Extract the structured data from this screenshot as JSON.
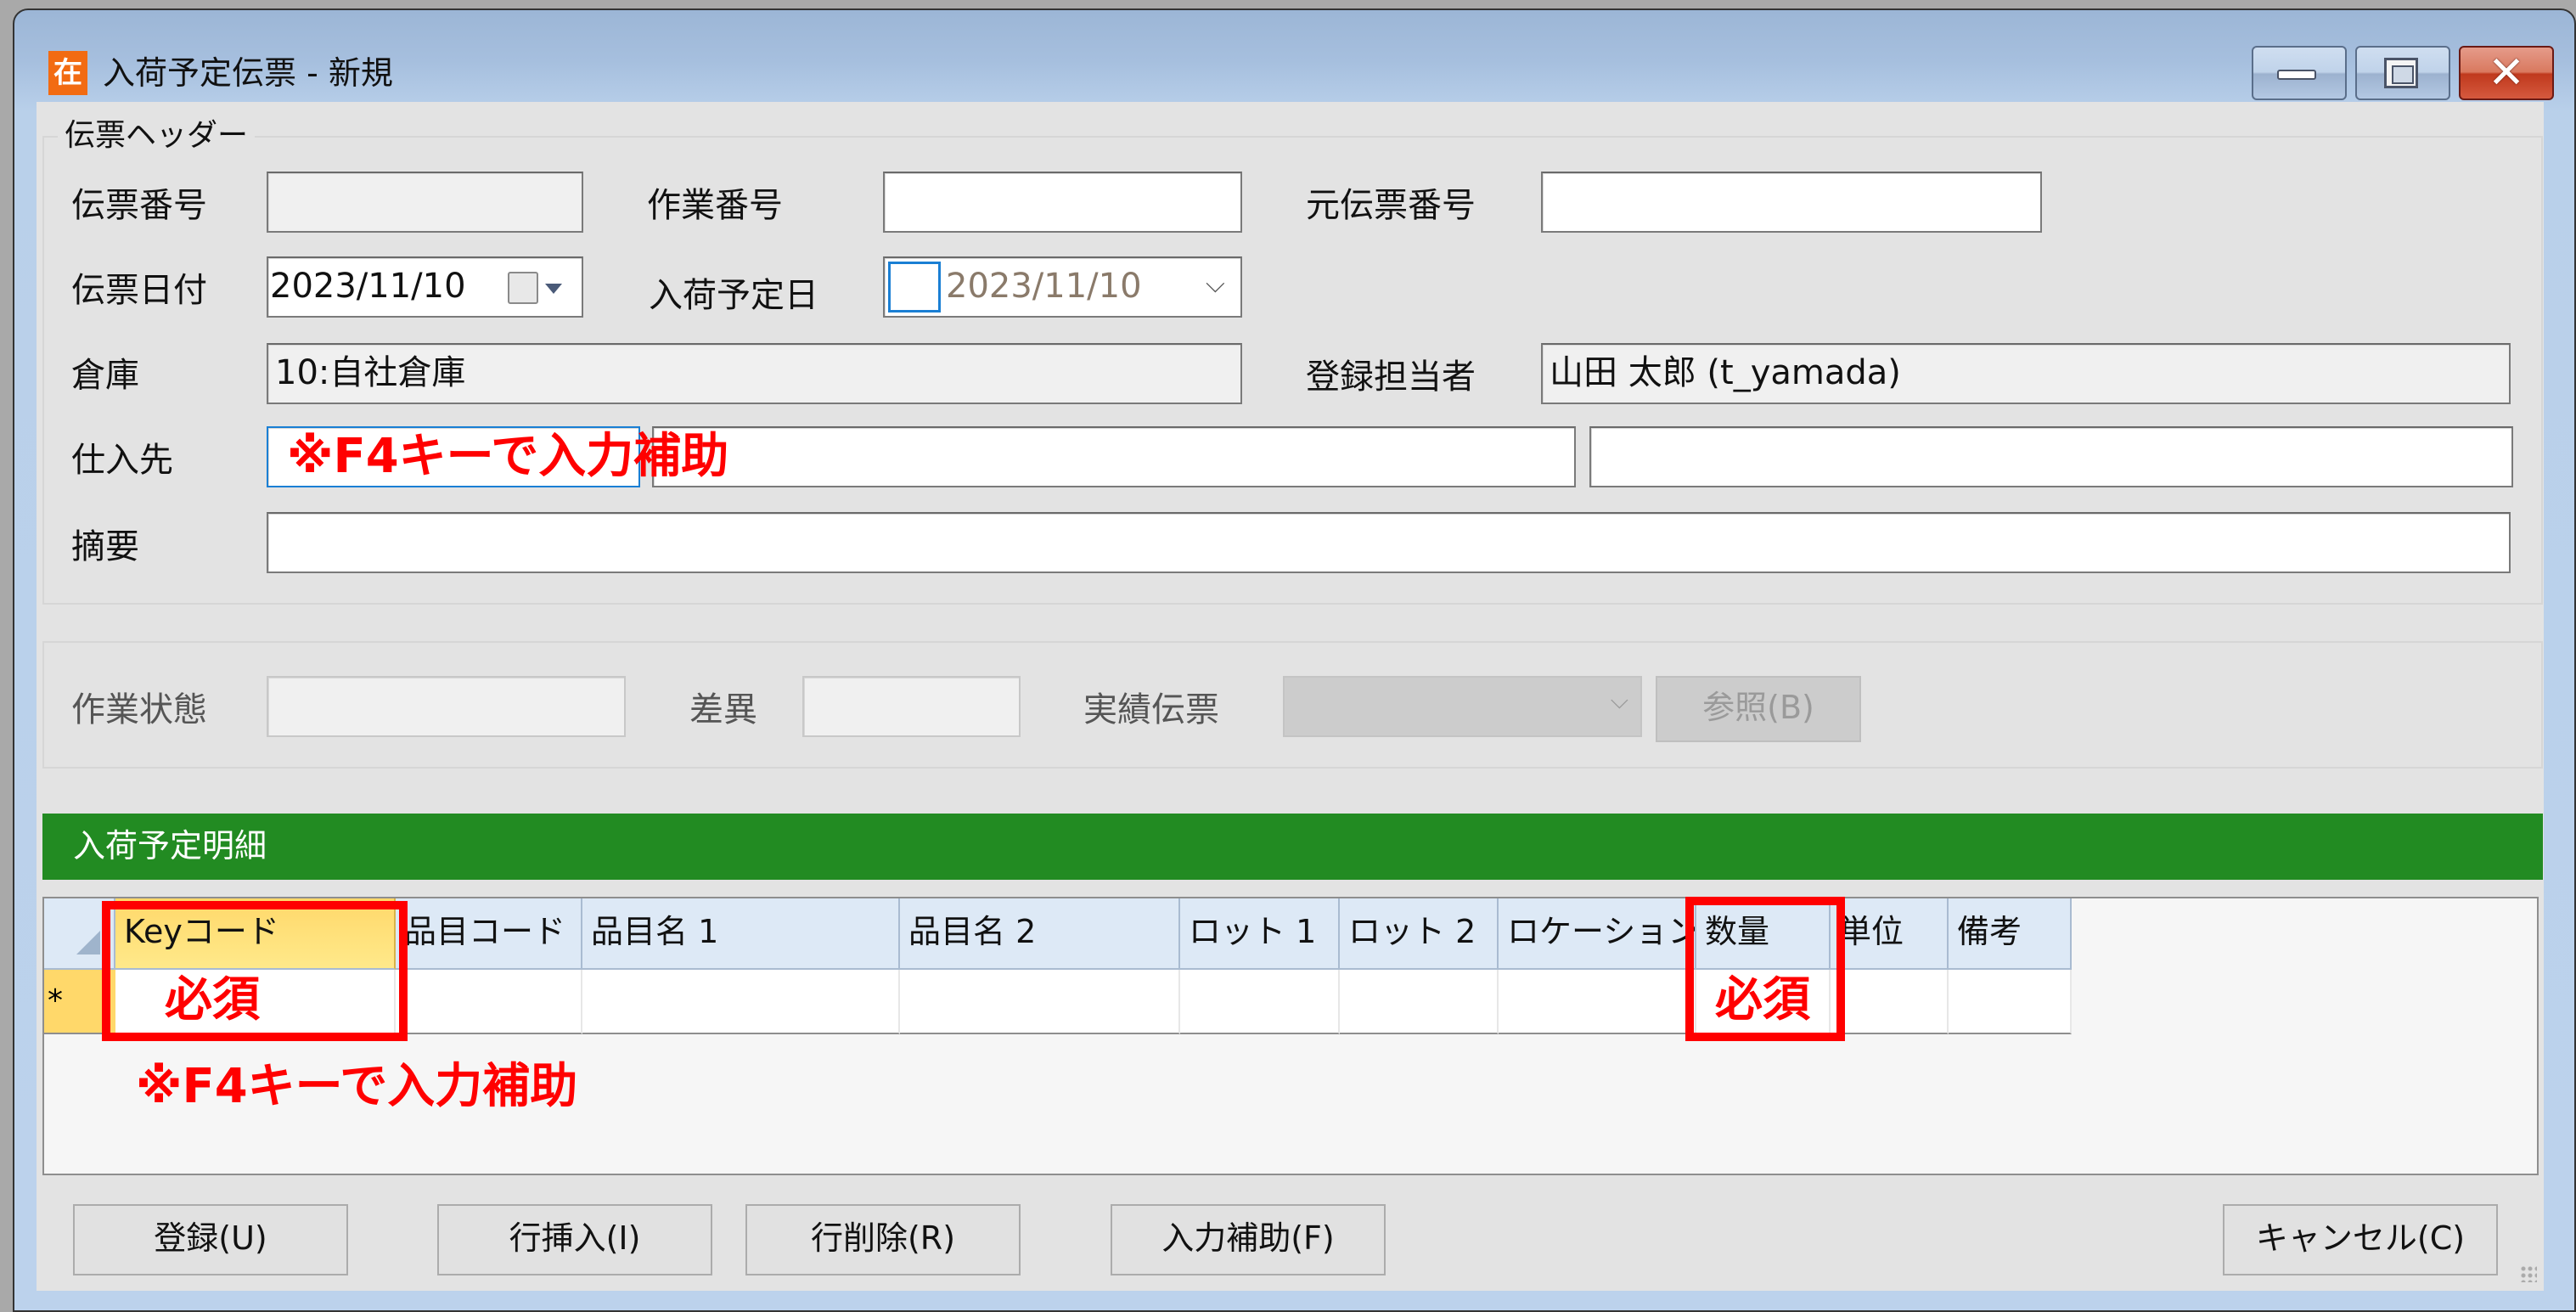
{
  "window": {
    "title": "入荷予定伝票 - 新規",
    "app_icon_glyph": "在",
    "controls": {
      "minimize": "minimize",
      "maximize": "maximize",
      "close": "✕"
    }
  },
  "header_group": {
    "title": "伝票ヘッダー",
    "fields": {
      "slip_number": {
        "label": "伝票番号",
        "value": ""
      },
      "work_number": {
        "label": "作業番号",
        "value": ""
      },
      "original_slip_number": {
        "label": "元伝票番号",
        "value": ""
      },
      "slip_date": {
        "label": "伝票日付",
        "value": "2023/11/10"
      },
      "arrival_date": {
        "label": "入荷予定日",
        "value": "2023/11/10",
        "checked": false
      },
      "warehouse": {
        "label": "倉庫",
        "value": "10:自社倉庫"
      },
      "registrant": {
        "label": "登録担当者",
        "value": "山田 太郎 (t_yamada)"
      },
      "supplier": {
        "label": "仕入先",
        "code": "",
        "name": "",
        "extra": ""
      },
      "memo": {
        "label": "摘要",
        "value": ""
      }
    }
  },
  "status_group": {
    "work_status": {
      "label": "作業状態",
      "value": ""
    },
    "difference": {
      "label": "差異",
      "value": ""
    },
    "actual_slip": {
      "label": "実績伝票",
      "value": ""
    },
    "reference_button": "参照(B)"
  },
  "detail": {
    "title": "入荷予定明細",
    "columns": [
      "Keyコード",
      "品目コード",
      "品目名 1",
      "品目名 2",
      "ロット 1",
      "ロット 2",
      "ロケーション",
      "数量",
      "単位",
      "備考"
    ],
    "new_row_marker": "*",
    "rows": []
  },
  "annotations": {
    "f4_hint": "※F4キーで入力補助",
    "required": "必須"
  },
  "buttons": {
    "register": "登録(U)",
    "insert_row": "行挿入(I)",
    "delete_row": "行削除(R)",
    "input_assist": "入力補助(F)",
    "cancel": "キャンセル(C)"
  },
  "colors": {
    "detail_bar": "#228b22",
    "annotation": "#ff0000",
    "app_icon": "#f26b12",
    "focus_border": "#1a7fd4"
  }
}
